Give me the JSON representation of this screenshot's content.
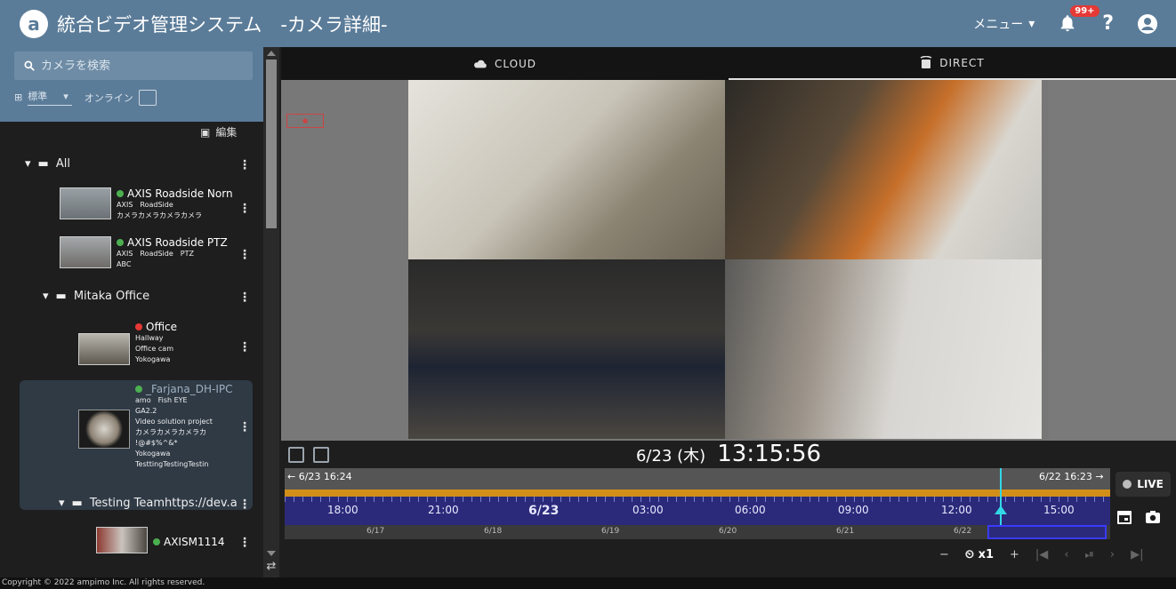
{
  "header": {
    "title": "統合ビデオ管理システム　-カメラ詳細-",
    "menu_label": "メニュー",
    "notification_count": "99+",
    "help_label": "?"
  },
  "sidebar": {
    "search_placeholder": "カメラを検索",
    "view_select": "標準",
    "online_filter": "オンライン",
    "edit_label": "編集",
    "folders": [
      {
        "name": "All"
      },
      {
        "name": "Mitaka Office"
      },
      {
        "name": "Testing Teamhttps://dev.a"
      }
    ],
    "cameras": [
      {
        "name": "AXIS Roadside Norn",
        "status": "online",
        "lines": [
          "AXIS　RoadSide",
          "カメラカメラカメラカメラ"
        ]
      },
      {
        "name": "AXIS Roadside PTZ",
        "status": "online",
        "lines": [
          "AXIS　RoadSide　PTZ",
          "ABC"
        ]
      },
      {
        "name": "Office",
        "status": "offline",
        "lines": [
          "Hallway",
          "Office cam",
          "Yokogawa"
        ]
      },
      {
        "name": "_Farjana_DH-IPC",
        "status": "online",
        "lines": [
          "amo　Fish EYE",
          "GA2.2",
          "Video solution project",
          "カメラカメラカメラカ",
          "!@#$%^&*",
          "Yokogawa",
          "TesttingTestingTestin"
        ]
      },
      {
        "name": "AXISM1114",
        "status": "online",
        "lines": []
      }
    ],
    "status_colors": {
      "online": "#4caf50",
      "offline": "#e53935"
    }
  },
  "tabs": [
    {
      "label": "CLOUD",
      "icon": "cloud-icon",
      "active": false
    },
    {
      "label": "DIRECT",
      "icon": "camera-direct-icon",
      "active": true
    }
  ],
  "player": {
    "date": "6/23 (木)",
    "time": "13:15:56",
    "range_start": "← 6/23 16:24",
    "range_end": "6/22 16:23 →",
    "hours": [
      "18:00",
      "21:00",
      "6/23",
      "03:00",
      "06:00",
      "09:00",
      "12:00",
      "15:00"
    ],
    "days": [
      "6/17",
      "6/18",
      "6/19",
      "6/20",
      "6/21",
      "6/22"
    ],
    "live_label": "LIVE",
    "speed": "x1",
    "minus": "−",
    "plus": "+"
  },
  "footer": {
    "copyright": "Copyright © 2022 ampimo Inc. All rights reserved."
  }
}
